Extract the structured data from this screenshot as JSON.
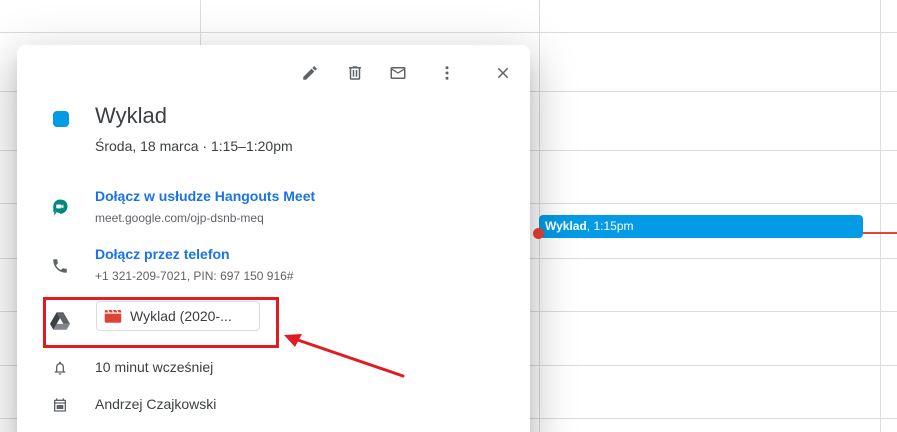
{
  "event_chip": {
    "title": "Wyklad",
    "time": ", 1:15pm",
    "color": "#039be5"
  },
  "toolbar": {
    "edit_icon": "pencil-icon",
    "delete_icon": "trash-icon",
    "email_icon": "mail-icon",
    "more_icon": "more-vert-icon",
    "close_icon": "close-icon"
  },
  "event": {
    "color": "#039be5",
    "title": "Wyklad",
    "date_time": "Środa, 18 marca  ·  1:15–1:20pm"
  },
  "meet": {
    "link_label": "Dołącz w usłudze Hangouts Meet",
    "url": "meet.google.com/ojp-dsnb-meq"
  },
  "phone": {
    "link_label": "Dołącz przez telefon",
    "details": "+1 321-209-7021, PIN: 697 150 916#"
  },
  "attachment": {
    "label": "Wyklad (2020-...",
    "icon": "video-file-icon"
  },
  "notification": {
    "label": "10 minut wcześniej"
  },
  "organizer": {
    "label": "Andrzej Czajkowski"
  },
  "annotation_color": "#e11b22"
}
